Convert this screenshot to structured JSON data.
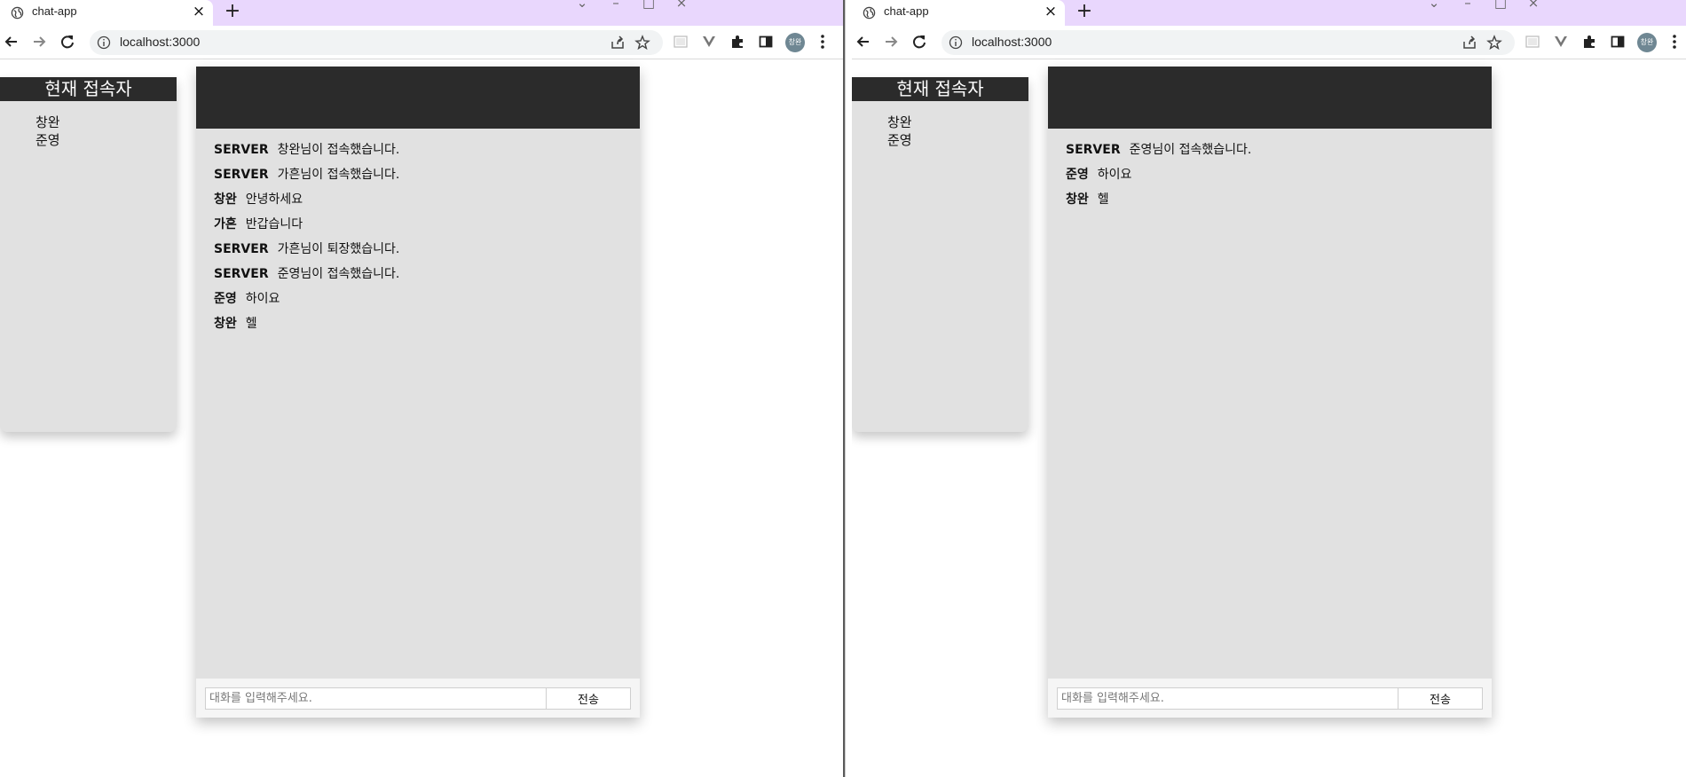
{
  "left": {
    "tab": {
      "title": "chat-app",
      "close": "×"
    },
    "new_tab": "+",
    "url": "localhost:3000",
    "avatar": "창완",
    "users_title": "현재 접속자",
    "users": [
      "창완",
      "준영"
    ],
    "messages": [
      {
        "sender": "SERVER",
        "text": "창완님이 접속했습니다."
      },
      {
        "sender": "SERVER",
        "text": "가흔님이 접속했습니다."
      },
      {
        "sender": "창완",
        "text": "안녕하세요"
      },
      {
        "sender": "가흔",
        "text": "반갑습니다"
      },
      {
        "sender": "SERVER",
        "text": "가흔님이 퇴장했습니다."
      },
      {
        "sender": "SERVER",
        "text": "준영님이 접속했습니다."
      },
      {
        "sender": "준영",
        "text": "하이요"
      },
      {
        "sender": "창완",
        "text": "헬"
      }
    ],
    "input_placeholder": "대화를 입력해주세요.",
    "send_label": "전송"
  },
  "right": {
    "tab": {
      "title": "chat-app",
      "close": "×"
    },
    "new_tab": "+",
    "url": "localhost:3000",
    "avatar": "창완",
    "users_title": "현재 접속자",
    "users": [
      "창완",
      "준영"
    ],
    "messages": [
      {
        "sender": "SERVER",
        "text": "준영님이 접속했습니다."
      },
      {
        "sender": "준영",
        "text": "하이요"
      },
      {
        "sender": "창완",
        "text": "헬"
      }
    ],
    "input_placeholder": "대화를 입력해주세요.",
    "send_label": "전송"
  },
  "colors": {
    "tabstrip": "#e9d7fd",
    "panel_bg": "#e1e1e1",
    "panel_header": "#2b2b2b",
    "avatar": "#6f8793"
  },
  "icons": [
    "globe-icon",
    "close-icon",
    "plus-icon",
    "back-icon",
    "forward-icon",
    "reload-icon",
    "info-icon",
    "share-icon",
    "star-icon",
    "extension-icon",
    "puzzle-icon",
    "sidepanel-icon",
    "menu-icon"
  ]
}
